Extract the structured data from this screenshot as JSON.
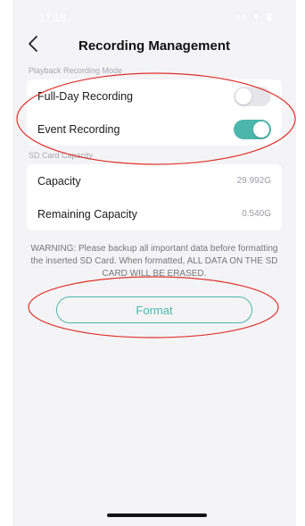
{
  "status_bar": {
    "time": "17:18",
    "icons": "•• ▾ ▮"
  },
  "nav": {
    "back_icon": "chevron-left-icon",
    "title": "Recording Management"
  },
  "playback": {
    "section_label": "Playback Recording Mode",
    "items": [
      {
        "label": "Full-Day Recording",
        "enabled": false
      },
      {
        "label": "Event Recording",
        "enabled": true
      }
    ]
  },
  "sd_card": {
    "section_label": "SD Card Capacity",
    "items": [
      {
        "label": "Capacity",
        "value": "29.992G"
      },
      {
        "label": "Remaining Capacity",
        "value": "0.540G"
      }
    ]
  },
  "warning": "WARNING: Please backup all important data before formatting the inserted SD Card. When formatted, ALL DATA ON THE SD CARD WILL BE ERASED.",
  "format_button": {
    "label": "Format"
  },
  "colors": {
    "accent": "#4db6ac",
    "annotation": "#e0312b",
    "toggle_off": "#e6e6ea"
  }
}
